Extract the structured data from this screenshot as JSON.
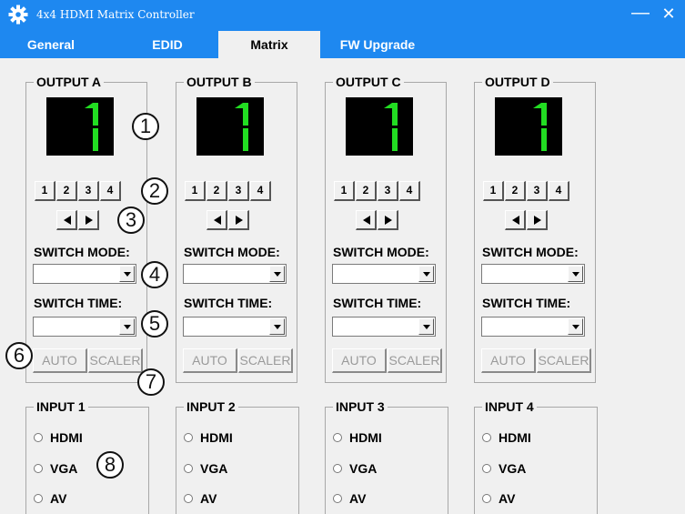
{
  "window": {
    "title": "4x4 HDMI Matrix Controller",
    "minimize_label": "—",
    "close_label": "✕"
  },
  "tabs": [
    {
      "label": "General",
      "active": false
    },
    {
      "label": "EDID",
      "active": false
    },
    {
      "label": "Matrix",
      "active": true
    },
    {
      "label": "FW Upgrade",
      "active": false
    }
  ],
  "outputs": [
    {
      "title": "OUTPUT A",
      "display_digit": "1",
      "buttons": [
        "1",
        "2",
        "3",
        "4"
      ],
      "switch_mode_label": "SWITCH MODE:",
      "switch_mode_value": "",
      "switch_time_label": "SWITCH TIME:",
      "switch_time_value": "",
      "auto_label": "AUTO",
      "scaler_label": "SCALER"
    },
    {
      "title": "OUTPUT B",
      "display_digit": "1",
      "buttons": [
        "1",
        "2",
        "3",
        "4"
      ],
      "switch_mode_label": "SWITCH MODE:",
      "switch_mode_value": "",
      "switch_time_label": "SWITCH TIME:",
      "switch_time_value": "",
      "auto_label": "AUTO",
      "scaler_label": "SCALER"
    },
    {
      "title": "OUTPUT C",
      "display_digit": "1",
      "buttons": [
        "1",
        "2",
        "3",
        "4"
      ],
      "switch_mode_label": "SWITCH MODE:",
      "switch_mode_value": "",
      "switch_time_label": "SWITCH TIME:",
      "switch_time_value": "",
      "auto_label": "AUTO",
      "scaler_label": "SCALER"
    },
    {
      "title": "OUTPUT D",
      "display_digit": "1",
      "buttons": [
        "1",
        "2",
        "3",
        "4"
      ],
      "switch_mode_label": "SWITCH MODE:",
      "switch_mode_value": "",
      "switch_time_label": "SWITCH TIME:",
      "switch_time_value": "",
      "auto_label": "AUTO",
      "scaler_label": "SCALER"
    }
  ],
  "inputs": [
    {
      "title": "INPUT 1",
      "options": [
        "HDMI",
        "VGA",
        "AV"
      ]
    },
    {
      "title": "INPUT 2",
      "options": [
        "HDMI",
        "VGA",
        "AV"
      ]
    },
    {
      "title": "INPUT 3",
      "options": [
        "HDMI",
        "VGA",
        "AV"
      ]
    },
    {
      "title": "INPUT 4",
      "options": [
        "HDMI",
        "VGA",
        "AV"
      ]
    }
  ],
  "callouts": [
    "1",
    "2",
    "3",
    "4",
    "5",
    "6",
    "7",
    "8"
  ],
  "colors": {
    "titlebar": "#1e88f0",
    "segment_display_bg": "#000000",
    "segment_on": "#22dd22"
  },
  "icons": {
    "app": "gear-icon",
    "prev": "triangle-left-icon",
    "next": "triangle-right-icon",
    "dropdown": "triangle-down-icon"
  }
}
